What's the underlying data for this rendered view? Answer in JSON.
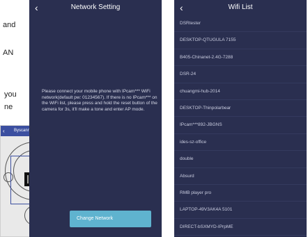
{
  "document": {
    "fragments": [
      "and",
      "AN",
      "you",
      "ne"
    ]
  },
  "qr_phone": {
    "header_title": "Byscanning QRCode",
    "back_icon": "chevron-left-icon"
  },
  "network_screen": {
    "title": "Network Setting",
    "back_icon": "chevron-left-icon",
    "instructions": "Please connect your mobile phone with IPcam*** WiFi network(default pw: 01234567). If there is no IPcam*** on the WiFi list, please press and hold the reset button of the camera for 3s, it'll make a tone and enter AP mode.",
    "button_label": "Change Network",
    "colors": {
      "background": "#2a2f50",
      "button": "#5fb3cf"
    }
  },
  "wifi_screen": {
    "title": "Wifi List",
    "back_icon": "chevron-left-icon",
    "networks": [
      "DSRtester",
      "DESKTOP-QTUGULA 7155",
      "B405-Chinanet-2.4G-7288",
      "DSR-24",
      "chuangmi-hub-2014",
      "DESKTOP-Thinpolarbear",
      "IPcam***892-JBGNS",
      "ides-sz-office",
      "double",
      "Absurd",
      "RMB player pro",
      "LAPTOP-49V3AK4A 5101",
      "DIRECT-bSXMYD-IPrpME"
    ]
  }
}
